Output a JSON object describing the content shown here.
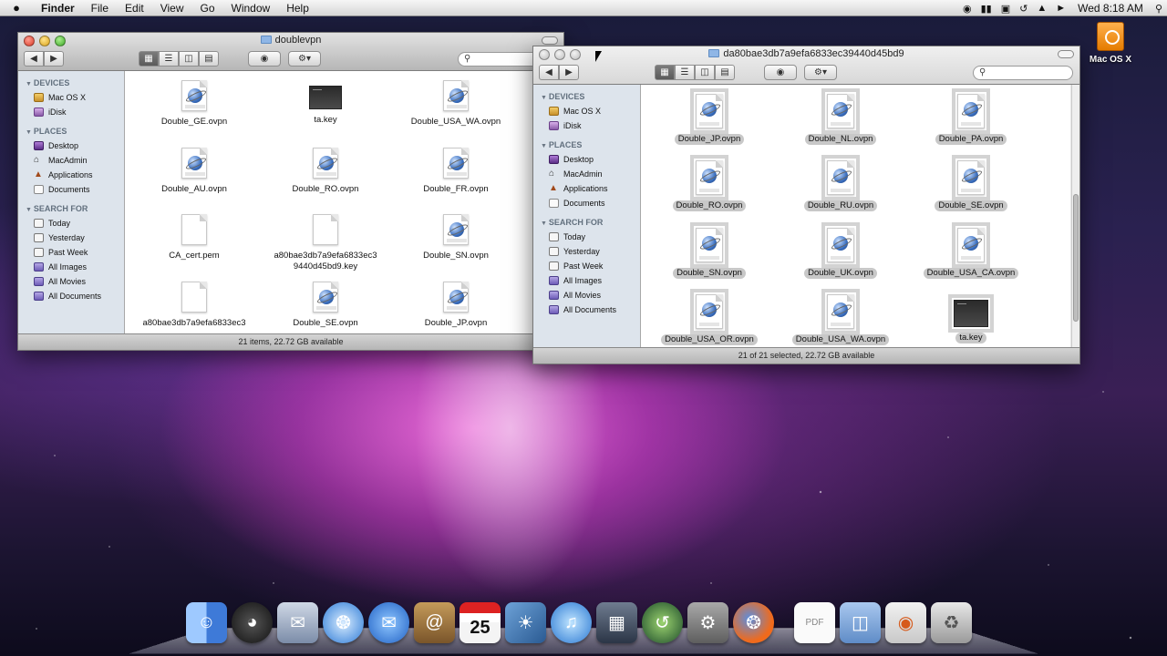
{
  "menubar": {
    "apple": "",
    "app": "Finder",
    "items": [
      "File",
      "Edit",
      "View",
      "Go",
      "Window",
      "Help"
    ],
    "clock": "Wed 8:18 AM"
  },
  "desktop": {
    "drive_label": "Mac OS X"
  },
  "window1": {
    "title": "doublevpn",
    "status": "21 items, 22.72 GB available",
    "sidebar": {
      "devices_header": "DEVICES",
      "devices": [
        "Mac OS X",
        "iDisk"
      ],
      "places_header": "PLACES",
      "places": [
        "Desktop",
        "MacAdmin",
        "Applications",
        "Documents"
      ],
      "search_header": "SEARCH FOR",
      "searches": [
        "Today",
        "Yesterday",
        "Past Week",
        "All Images",
        "All Movies",
        "All Documents"
      ]
    },
    "files": [
      {
        "name": "Double_GE.ovpn",
        "kind": "vpn"
      },
      {
        "name": "ta.key",
        "kind": "key"
      },
      {
        "name": "Double_USA_WA.ovpn",
        "kind": "vpn"
      },
      {
        "name": "Double_AU.ovpn",
        "kind": "vpn"
      },
      {
        "name": "Double_RO.ovpn",
        "kind": "vpn"
      },
      {
        "name": "Double_FR.ovpn",
        "kind": "vpn"
      },
      {
        "name": "CA_cert.pem",
        "kind": "blank"
      },
      {
        "name": "a80bae3db7a9efa6833ec3\n9440d45bd9.key",
        "kind": "blank"
      },
      {
        "name": "Double_SN.ovpn",
        "kind": "vpn"
      },
      {
        "name": "a80bae3db7a9efa6833ec3",
        "kind": "blank"
      },
      {
        "name": "Double_SE.ovpn",
        "kind": "vpn"
      },
      {
        "name": "Double_JP.ovpn",
        "kind": "vpn"
      }
    ]
  },
  "window2": {
    "title": "da80bae3db7a9efa6833ec39440d45bd9",
    "status": "21 of 21 selected, 22.72 GB available",
    "sidebar": {
      "devices_header": "DEVICES",
      "devices": [
        "Mac OS X",
        "iDisk"
      ],
      "places_header": "PLACES",
      "places": [
        "Desktop",
        "MacAdmin",
        "Applications",
        "Documents"
      ],
      "search_header": "SEARCH FOR",
      "searches": [
        "Today",
        "Yesterday",
        "Past Week",
        "All Images",
        "All Movies",
        "All Documents"
      ]
    },
    "files": [
      {
        "name": "Double_JP.ovpn",
        "kind": "vpn"
      },
      {
        "name": "Double_NL.ovpn",
        "kind": "vpn"
      },
      {
        "name": "Double_PA.ovpn",
        "kind": "vpn"
      },
      {
        "name": "Double_RO.ovpn",
        "kind": "vpn"
      },
      {
        "name": "Double_RU.ovpn",
        "kind": "vpn"
      },
      {
        "name": "Double_SE.ovpn",
        "kind": "vpn"
      },
      {
        "name": "Double_SN.ovpn",
        "kind": "vpn"
      },
      {
        "name": "Double_UK.ovpn",
        "kind": "vpn"
      },
      {
        "name": "Double_USA_CA.ovpn",
        "kind": "vpn"
      },
      {
        "name": "Double_USA_OR.ovpn",
        "kind": "vpn"
      },
      {
        "name": "Double_USA_WA.ovpn",
        "kind": "vpn"
      },
      {
        "name": "ta.key",
        "kind": "key"
      }
    ]
  },
  "dock": {
    "calendar_day": "25",
    "icons": [
      "finder-icon",
      "dashboard-icon",
      "mail-icon",
      "safari-icon",
      "ichat-icon",
      "address-book-icon",
      "ical-icon",
      "iphoto-icon",
      "itunes-icon",
      "spaces-icon",
      "time-machine-icon",
      "system-preferences-icon",
      "firefox-icon",
      "pdf-document-icon",
      "folder-icon",
      "downloads-icon",
      "trash-icon"
    ]
  }
}
